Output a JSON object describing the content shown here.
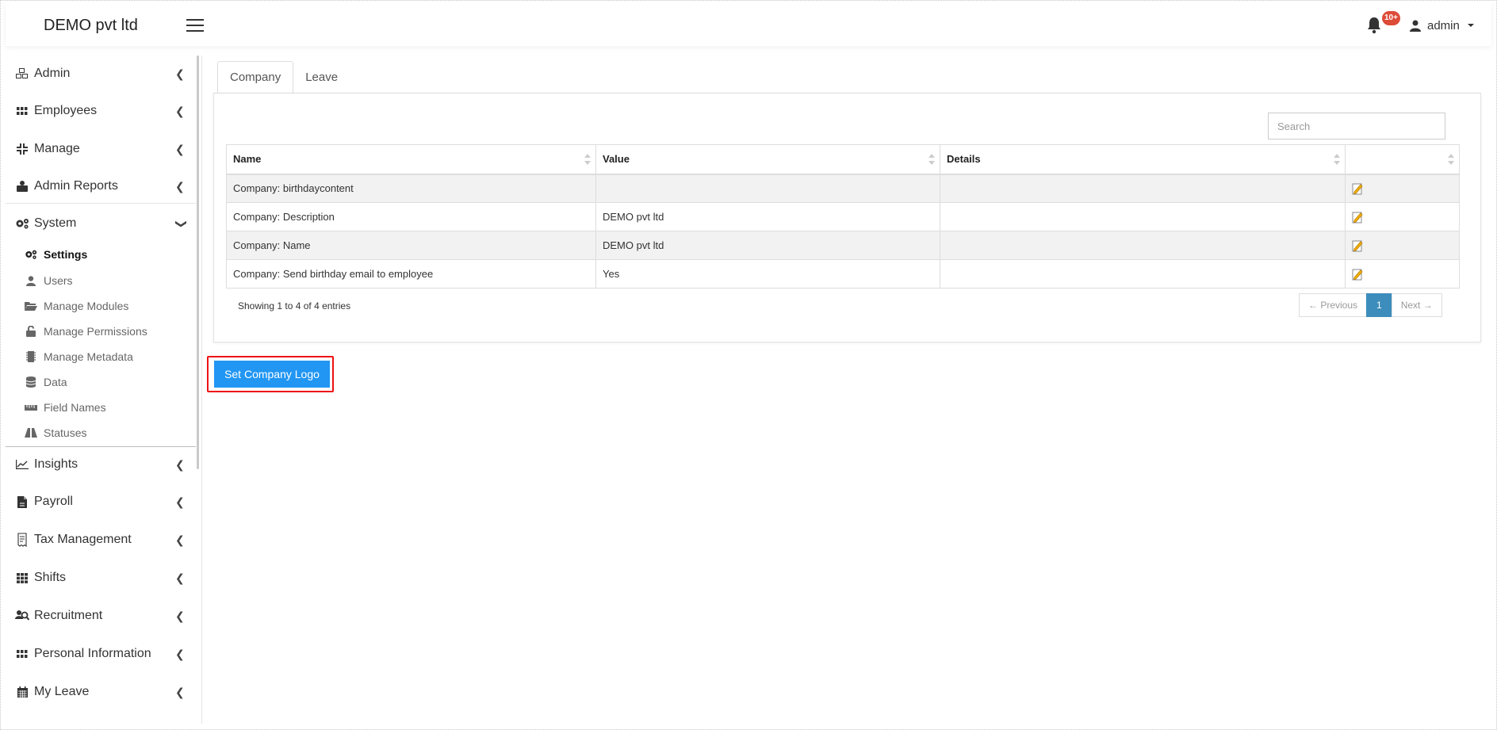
{
  "app": {
    "brand": "DEMO pvt ltd"
  },
  "header": {
    "notifications_badge": "10+",
    "user_label": "admin"
  },
  "sidebar": {
    "top_items": [
      {
        "label": "Admin",
        "icon": "cubes-icon"
      },
      {
        "label": "Employees",
        "icon": "th-icon"
      },
      {
        "label": "Manage",
        "icon": "compress-icon"
      },
      {
        "label": "Admin Reports",
        "icon": "user-tie-icon"
      },
      {
        "label": "System",
        "icon": "cogs-icon"
      }
    ],
    "system_sub_items": [
      {
        "label": "Settings",
        "icon": "cogs-icon",
        "active": true
      },
      {
        "label": "Users",
        "icon": "user-icon"
      },
      {
        "label": "Manage Modules",
        "icon": "folder-open-icon"
      },
      {
        "label": "Manage Permissions",
        "icon": "unlock-icon"
      },
      {
        "label": "Manage Metadata",
        "icon": "microchip-icon"
      },
      {
        "label": "Data",
        "icon": "database-icon"
      },
      {
        "label": "Field Names",
        "icon": "ruler-icon"
      },
      {
        "label": "Statuses",
        "icon": "road-icon"
      }
    ],
    "bottom_items": [
      {
        "label": "Insights",
        "icon": "line-chart-icon"
      },
      {
        "label": "Payroll",
        "icon": "file-icon"
      },
      {
        "label": "Tax Management",
        "icon": "receipt-icon"
      },
      {
        "label": "Shifts",
        "icon": "grid-icon"
      },
      {
        "label": "Recruitment",
        "icon": "user-search-icon"
      },
      {
        "label": "Personal Information",
        "icon": "th-icon"
      },
      {
        "label": "My Leave",
        "icon": "calendar-icon"
      }
    ]
  },
  "tabs": [
    {
      "label": "Company",
      "active": true
    },
    {
      "label": "Leave",
      "active": false
    }
  ],
  "search": {
    "placeholder": "Search"
  },
  "table": {
    "columns": [
      "Name",
      "Value",
      "Details",
      ""
    ],
    "rows": [
      {
        "name": "Company: birthdaycontent",
        "value": "",
        "details": ""
      },
      {
        "name": "Company: Description",
        "value": "DEMO pvt ltd",
        "details": ""
      },
      {
        "name": "Company: Name",
        "value": "DEMO pvt ltd",
        "details": ""
      },
      {
        "name": "Company: Send birthday email to employee",
        "value": "Yes",
        "details": ""
      }
    ]
  },
  "pagination": {
    "info": "Showing 1 to 4 of 4 entries",
    "previous": "← Previous",
    "current_page": "1",
    "next": "Next →"
  },
  "actions": {
    "set_company_logo": "Set Company Logo"
  },
  "colors": {
    "primary_button": "#2196f3",
    "highlight_border": "#ee1111",
    "badge": "#dd4b39",
    "active_page": "#3c8dbc"
  }
}
